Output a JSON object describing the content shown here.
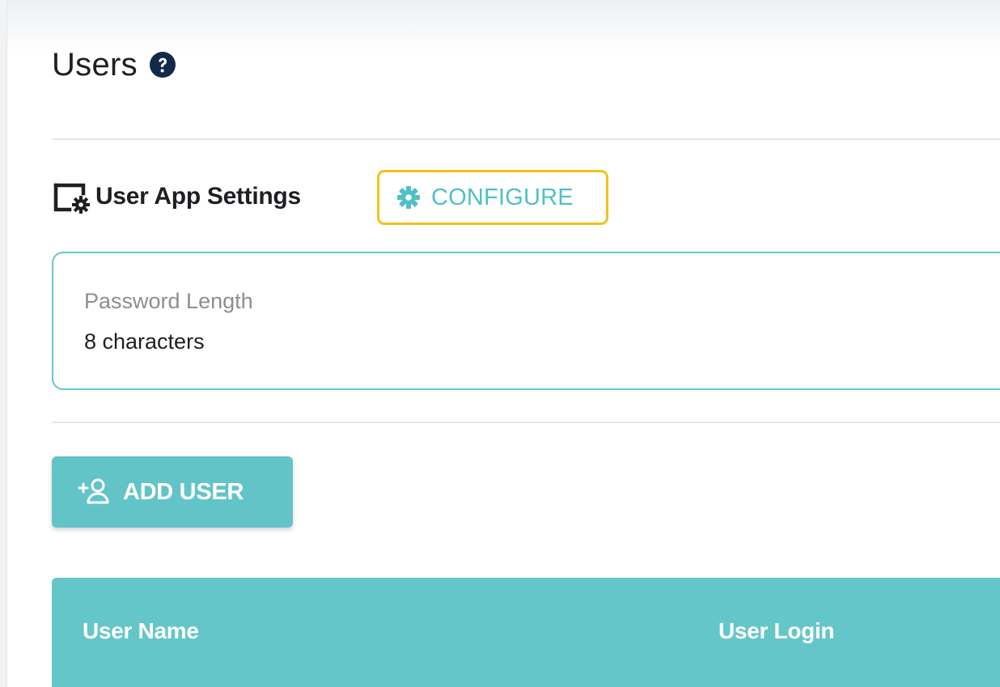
{
  "page": {
    "title": "Users"
  },
  "icons": {
    "help": "question-circle-icon",
    "app_settings": "app-window-gear-icon",
    "configure": "gear-icon",
    "add_user": "add-user-icon"
  },
  "user_app_settings": {
    "title": "User App Settings",
    "configure_label": "CONFIGURE",
    "fields": [
      {
        "label": "Password Length",
        "value": "8 characters"
      }
    ]
  },
  "actions": {
    "add_user_label": "ADD USER"
  },
  "table": {
    "columns": [
      "User Name",
      "User Login"
    ]
  },
  "colors": {
    "accent": "#63c4c8",
    "highlight_border": "#f2c318",
    "text_primary": "#1d1f22",
    "text_muted": "#8a8f94"
  }
}
